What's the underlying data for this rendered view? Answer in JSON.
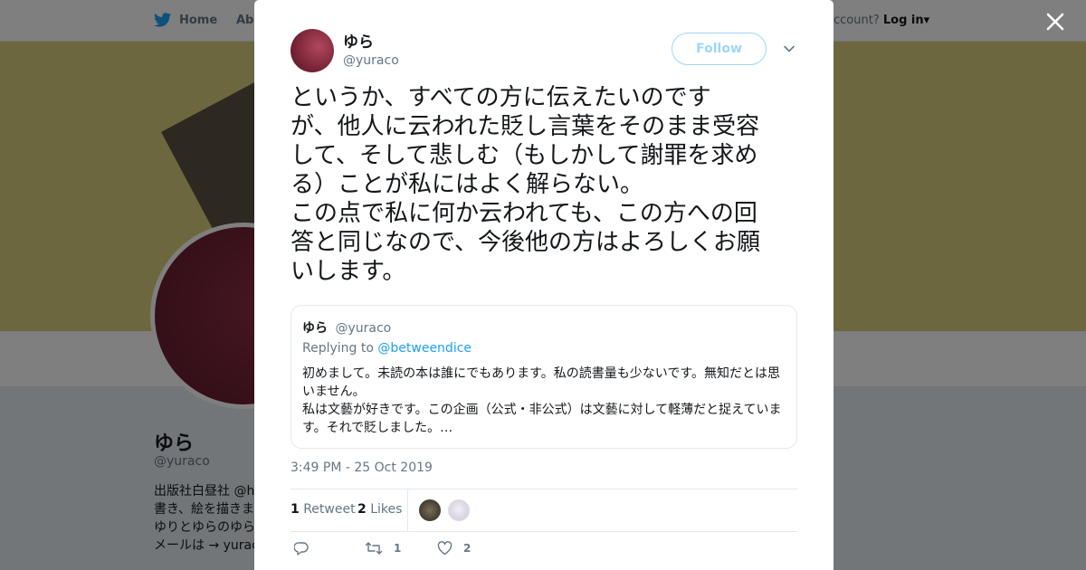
{
  "background": {
    "nav": {
      "home_label": "Home",
      "about_label": "Abo",
      "account_text": "ccount?",
      "login_label": "Log in"
    },
    "profile": {
      "name": "ゆら",
      "handle": "@yuraco",
      "bio_lines": [
        "出版社白昼社 @h",
        "書き、絵を描きま",
        "ゆりとゆらのゆら",
        "メールは → yurac"
      ]
    }
  },
  "tweet": {
    "author_name": "ゆら",
    "author_handle": "@yuraco",
    "follow_label": "Follow",
    "text": "というか、すべての方に伝えたいのです\nが、他人に云われた貶し言葉をそのまま受容\nして、そして悲しむ（もしかして謝罪を求め\nる）ことが私にはよく解らない。\nこの点で私に何か云われても、この方への回\n答と同じなので、今後他の方はよろしくお願\nいします。",
    "quoted": {
      "name": "ゆら",
      "handle": "@yuraco",
      "replying_prefix": "Replying to",
      "replying_to": "@betweendice",
      "body": "初めまして。未読の本は誰にでもあります。私の読書量も少ないです。無知だとは思\nいません。\n私は文藝が好きです。この企画（公式・非公式）は文藝に対して軽薄だと捉えていま\nす。それで貶しました。…"
    },
    "timestamp": "3:49 PM - 25 Oct 2019",
    "retweets_count": "1",
    "retweets_label": "Retweet",
    "likes_count": "2",
    "likes_label": "Likes",
    "actions": {
      "retweet_count": "1",
      "like_count": "2"
    }
  },
  "colors": {
    "accent": "#1da1f2",
    "follow_border": "#9fd6f9",
    "secondary_text": "#657786"
  }
}
